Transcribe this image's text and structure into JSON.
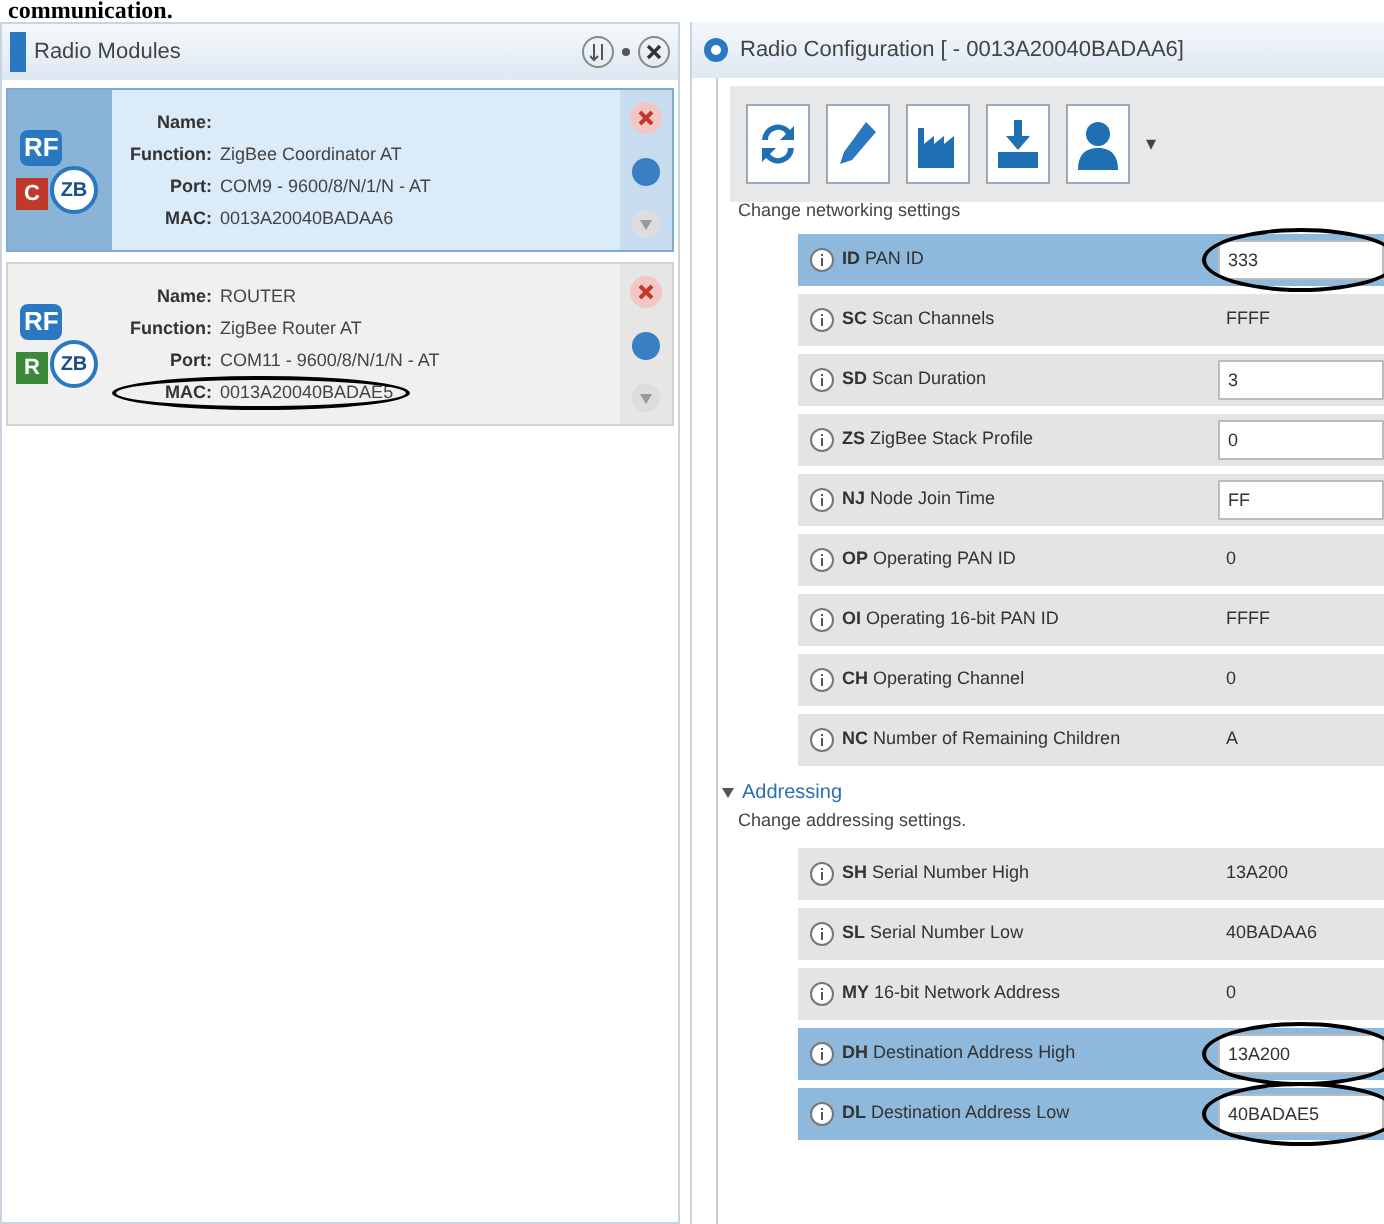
{
  "caption": "communication.",
  "modules_panel": {
    "title": "Radio Modules",
    "modules": [
      {
        "selected": true,
        "rf": "RF",
        "zb": "ZB",
        "badge": "C",
        "color": "#c0392b",
        "fields": [
          {
            "label": "Name:",
            "circled": false
          },
          {
            "label": "Function:",
            "value": "ZigBee Coordinator AT",
            "circled": false
          },
          {
            "label": "Port:",
            "value": "COM9 - 9600/8/N/1/N - AT",
            "circled": false
          },
          {
            "label": "MAC:",
            "value": "0013A20040BADAA6",
            "circled": false
          }
        ]
      },
      {
        "selected": false,
        "rf": "RF",
        "zb": "ZB",
        "badge": "R",
        "color": "#3a8a3a",
        "fields": [
          {
            "label": "Name:",
            "value": "ROUTER",
            "circled": false
          },
          {
            "label": "Function:",
            "value": "ZigBee Router AT",
            "circled": false
          },
          {
            "label": "Port:",
            "value": "COM11 - 9600/8/N/1/N - AT",
            "circled": false
          },
          {
            "label": "MAC:",
            "value": "0013A20040BADAE5",
            "circled": true
          }
        ]
      }
    ]
  },
  "config_panel": {
    "title": "Radio Configuration [ - 0013A20040BADAA6]",
    "toolbar_caret": "▾",
    "sections": [
      {
        "description": "Change networking settings",
        "rows": [
          {
            "code": "ID",
            "label": "PAN ID",
            "value": "333",
            "kind": "field",
            "highlighted": true,
            "circled": true
          },
          {
            "code": "SC",
            "label": "Scan Channels",
            "value": "FFFF",
            "kind": "readonly",
            "highlighted": false,
            "circled": false
          },
          {
            "code": "SD",
            "label": "Scan Duration",
            "value": "3",
            "kind": "field",
            "highlighted": false,
            "circled": false
          },
          {
            "code": "ZS",
            "label": "ZigBee Stack Profile",
            "value": "0",
            "kind": "field",
            "highlighted": false,
            "circled": false
          },
          {
            "code": "NJ",
            "label": "Node Join Time",
            "value": "FF",
            "kind": "field",
            "highlighted": false,
            "circled": false
          },
          {
            "code": "OP",
            "label": "Operating PAN ID",
            "value": "0",
            "kind": "readonly",
            "highlighted": false,
            "circled": false
          },
          {
            "code": "OI",
            "label": "Operating 16-bit PAN ID",
            "value": "FFFF",
            "kind": "readonly",
            "highlighted": false,
            "circled": false
          },
          {
            "code": "CH",
            "label": "Operating Channel",
            "value": "0",
            "kind": "readonly",
            "highlighted": false,
            "circled": false
          },
          {
            "code": "NC",
            "label": "Number of Remaining Children",
            "value": "A",
            "kind": "readonly",
            "highlighted": false,
            "circled": false
          }
        ]
      },
      {
        "heading": "Addressing",
        "description": "Change addressing settings.",
        "rows": [
          {
            "code": "SH",
            "label": "Serial Number High",
            "value": "13A200",
            "kind": "readonly",
            "highlighted": false,
            "circled": false
          },
          {
            "code": "SL",
            "label": "Serial Number Low",
            "value": "40BADAA6",
            "kind": "readonly",
            "highlighted": false,
            "circled": false
          },
          {
            "code": "MY",
            "label": "16-bit Network Address",
            "value": "0",
            "kind": "readonly",
            "highlighted": false,
            "circled": false
          },
          {
            "code": "DH",
            "label": "Destination Address High",
            "value": "13A200",
            "kind": "field",
            "highlighted": true,
            "circled": true
          },
          {
            "code": "DL",
            "label": "Destination Address Low",
            "value": "40BADAE5",
            "kind": "field",
            "highlighted": true,
            "circled": true
          }
        ]
      }
    ]
  }
}
